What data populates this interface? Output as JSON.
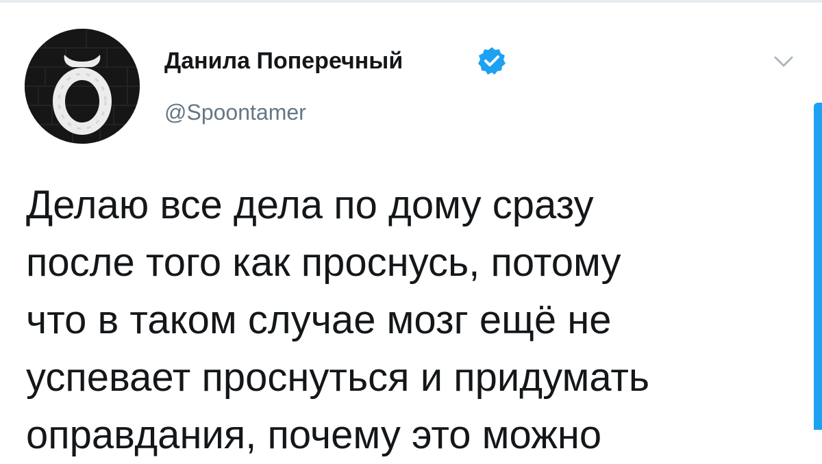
{
  "tweet": {
    "author": {
      "display_name": "Данила Поперечный",
      "handle": "@Spoontamer",
      "verified": true,
      "avatar_icon": "white-painted-circle-with-horns-on-black-brick-wall",
      "verified_icon": "verified-badge-icon",
      "verified_color": "#1da1f2"
    },
    "menu_icon": "chevron-down-icon",
    "text": "Делаю все дела по дому сразу\nпосле того как проснусь, потому\nчто в таком случае мозг ещё не\nуспевает проснуться и придумать\nоправдания, почему это можно"
  },
  "colors": {
    "text": "#14171a",
    "secondary_text": "#657786",
    "accent": "#1da1f2",
    "divider": "#e6ecf0",
    "background": "#ffffff"
  }
}
